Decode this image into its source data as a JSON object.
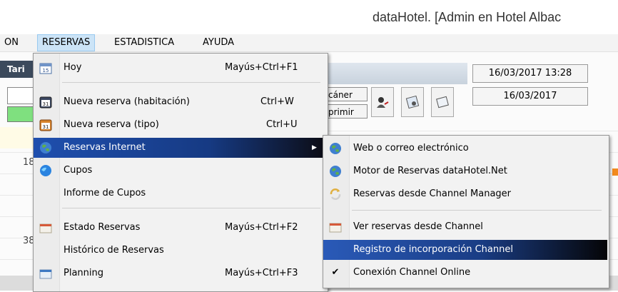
{
  "window": {
    "title": "dataHotel. [Admin en Hotel Albac"
  },
  "menubar": [
    {
      "label": "ON"
    },
    {
      "label": "RESERVAS"
    },
    {
      "label": "ESTADISTICA"
    },
    {
      "label": "AYUDA"
    }
  ],
  "background": {
    "dark_header": "Tari",
    "datetime": "16/03/2017 13:28",
    "date": "16/03/2017",
    "scan_label": "cáner",
    "print_label": "primir",
    "row_numbers": [
      "18",
      "38"
    ]
  },
  "main_menu": [
    {
      "label": "Hoy",
      "shortcut": "Mayús+Ctrl+F1",
      "icon": "calendar-15-icon"
    },
    {
      "label": "Nueva reserva (habitación)",
      "shortcut": "Ctrl+W",
      "icon": "calendar-31-icon"
    },
    {
      "label": "Nueva reserva (tipo)",
      "shortcut": "Ctrl+U",
      "icon": "calendar-31-orange-icon"
    },
    {
      "label": "Reservas Internet",
      "shortcut": "",
      "icon": "globe-icon"
    },
    {
      "label": "Cupos",
      "shortcut": "",
      "icon": "globe-blue-icon"
    },
    {
      "label": "Informe de Cupos",
      "shortcut": "",
      "icon": ""
    },
    {
      "label": "Estado Reservas",
      "shortcut": "Mayús+Ctrl+F2",
      "icon": "folder-red-icon"
    },
    {
      "label": "Histórico de Reservas",
      "shortcut": "",
      "icon": ""
    },
    {
      "label": "Planning",
      "shortcut": "Mayús+Ctrl+F3",
      "icon": "folder-blue-icon"
    }
  ],
  "sub_menu": [
    {
      "label": "Web o correo electrónico",
      "icon": "globe-icon"
    },
    {
      "label": "Motor de Reservas dataHotel.Net",
      "icon": "globe-icon"
    },
    {
      "label": "Reservas desde Channel Manager",
      "icon": "sync-icon"
    },
    {
      "label": "Ver reservas desde Channel",
      "icon": "folder-red-icon"
    },
    {
      "label": "Registro de incorporación Channel",
      "icon": ""
    },
    {
      "label": "Conexión Channel Online",
      "icon": "check-icon"
    }
  ],
  "colors": {
    "highlight": "#1f4fae",
    "menu_bg": "#f2f2f2",
    "menubar_active": "#cce4f7"
  }
}
